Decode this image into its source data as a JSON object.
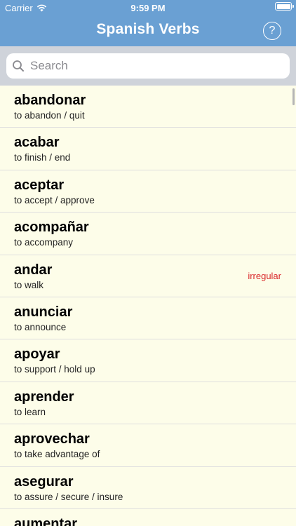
{
  "status_bar": {
    "carrier": "Carrier",
    "time": "9:59 PM"
  },
  "nav": {
    "title": "Spanish Verbs",
    "help_label": "?"
  },
  "search": {
    "placeholder": "Search",
    "value": ""
  },
  "verbs": [
    {
      "verb": "abandonar",
      "meaning": "to abandon / quit",
      "badge": ""
    },
    {
      "verb": "acabar",
      "meaning": "to finish / end",
      "badge": ""
    },
    {
      "verb": "aceptar",
      "meaning": "to accept / approve",
      "badge": ""
    },
    {
      "verb": "acompañar",
      "meaning": "to accompany",
      "badge": ""
    },
    {
      "verb": "andar",
      "meaning": "to walk",
      "badge": "irregular"
    },
    {
      "verb": "anunciar",
      "meaning": "to announce",
      "badge": ""
    },
    {
      "verb": "apoyar",
      "meaning": "to support / hold up",
      "badge": ""
    },
    {
      "verb": "aprender",
      "meaning": "to learn",
      "badge": ""
    },
    {
      "verb": "aprovechar",
      "meaning": "to take advantage of",
      "badge": ""
    },
    {
      "verb": "asegurar",
      "meaning": "to assure / secure / insure",
      "badge": ""
    },
    {
      "verb": "aumentar",
      "meaning": "",
      "badge": ""
    }
  ],
  "colors": {
    "header": "#6aa0d3",
    "list_background": "#fdfde9",
    "irregular_badge": "#d9282a"
  }
}
